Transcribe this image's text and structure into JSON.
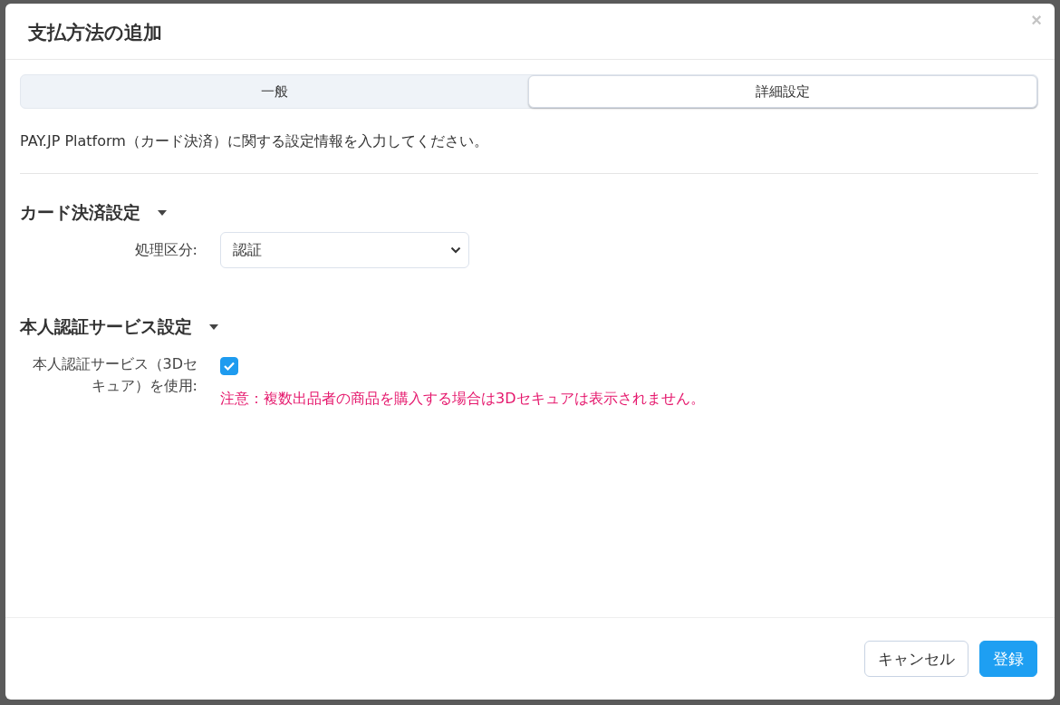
{
  "dialog": {
    "title": "支払方法の追加",
    "close": "×"
  },
  "tabs": [
    {
      "label": "一般",
      "selected": false
    },
    {
      "label": "詳細設定",
      "selected": true
    }
  ],
  "intro": "PAY.JP Platform（カード決済）に関する設定情報を入力してください。",
  "sections": [
    {
      "title": "カード決済設定",
      "expanded": true,
      "fields": [
        {
          "kind": "select",
          "label": "処理区分:",
          "value": "認証"
        }
      ]
    },
    {
      "title": "本人認証サービス設定",
      "expanded": true,
      "fields": [
        {
          "kind": "checkbox",
          "label": "本人認証サービス（3Dセキュア）を使用:",
          "checked": true,
          "note": "注意：複数出品者の商品を購入する場合は3Dセキュアは表示されません。"
        }
      ]
    }
  ],
  "buttons": [
    {
      "label": "キャンセル",
      "kind": "secondary"
    },
    {
      "label": "登録",
      "kind": "primary"
    }
  ]
}
